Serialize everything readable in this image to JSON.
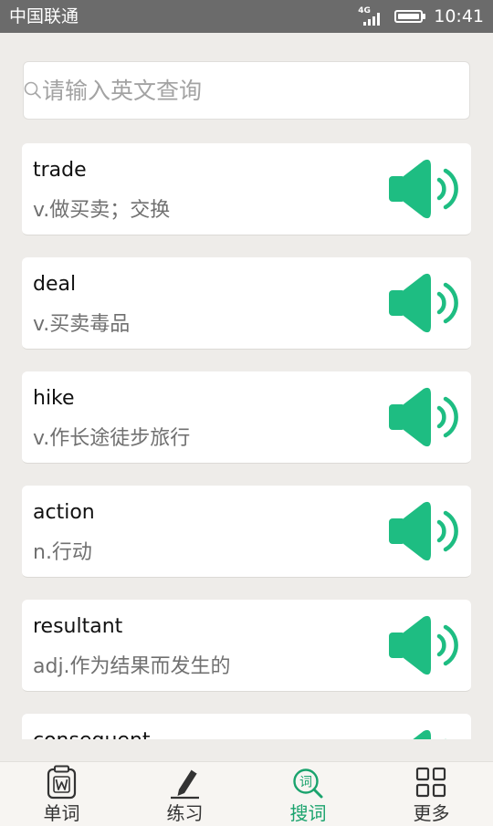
{
  "status_bar": {
    "carrier": "中国联通",
    "network": "4G",
    "time": "10:41"
  },
  "search": {
    "placeholder": "请输入英文查询",
    "value": "",
    "icon": "search-icon"
  },
  "words": [
    {
      "word": "trade",
      "meaning": "v.做买卖；交换",
      "icon": "speaker-icon"
    },
    {
      "word": "deal",
      "meaning": "v.买卖毒品",
      "icon": "speaker-icon"
    },
    {
      "word": "hike",
      "meaning": "v.作长途徒步旅行",
      "icon": "speaker-icon"
    },
    {
      "word": "action",
      "meaning": "n.行动",
      "icon": "speaker-icon"
    },
    {
      "word": "resultant",
      "meaning": "adj.作为结果而发生的",
      "icon": "speaker-icon"
    },
    {
      "word": "consequent",
      "meaning": "",
      "icon": "speaker-icon"
    }
  ],
  "bottom_nav": {
    "items": [
      {
        "label": "单词",
        "icon": "notebook-w-icon",
        "active": false
      },
      {
        "label": "练习",
        "icon": "pencil-icon",
        "active": false
      },
      {
        "label": "搜词",
        "icon": "search-word-icon",
        "badge_text": "词",
        "active": true
      },
      {
        "label": "更多",
        "icon": "grid-icon",
        "active": false
      }
    ]
  },
  "colors": {
    "accent": "#1ebd82",
    "active_nav": "#1aa36d",
    "status_bar": "#6b6b6b",
    "background": "#eeece9"
  }
}
